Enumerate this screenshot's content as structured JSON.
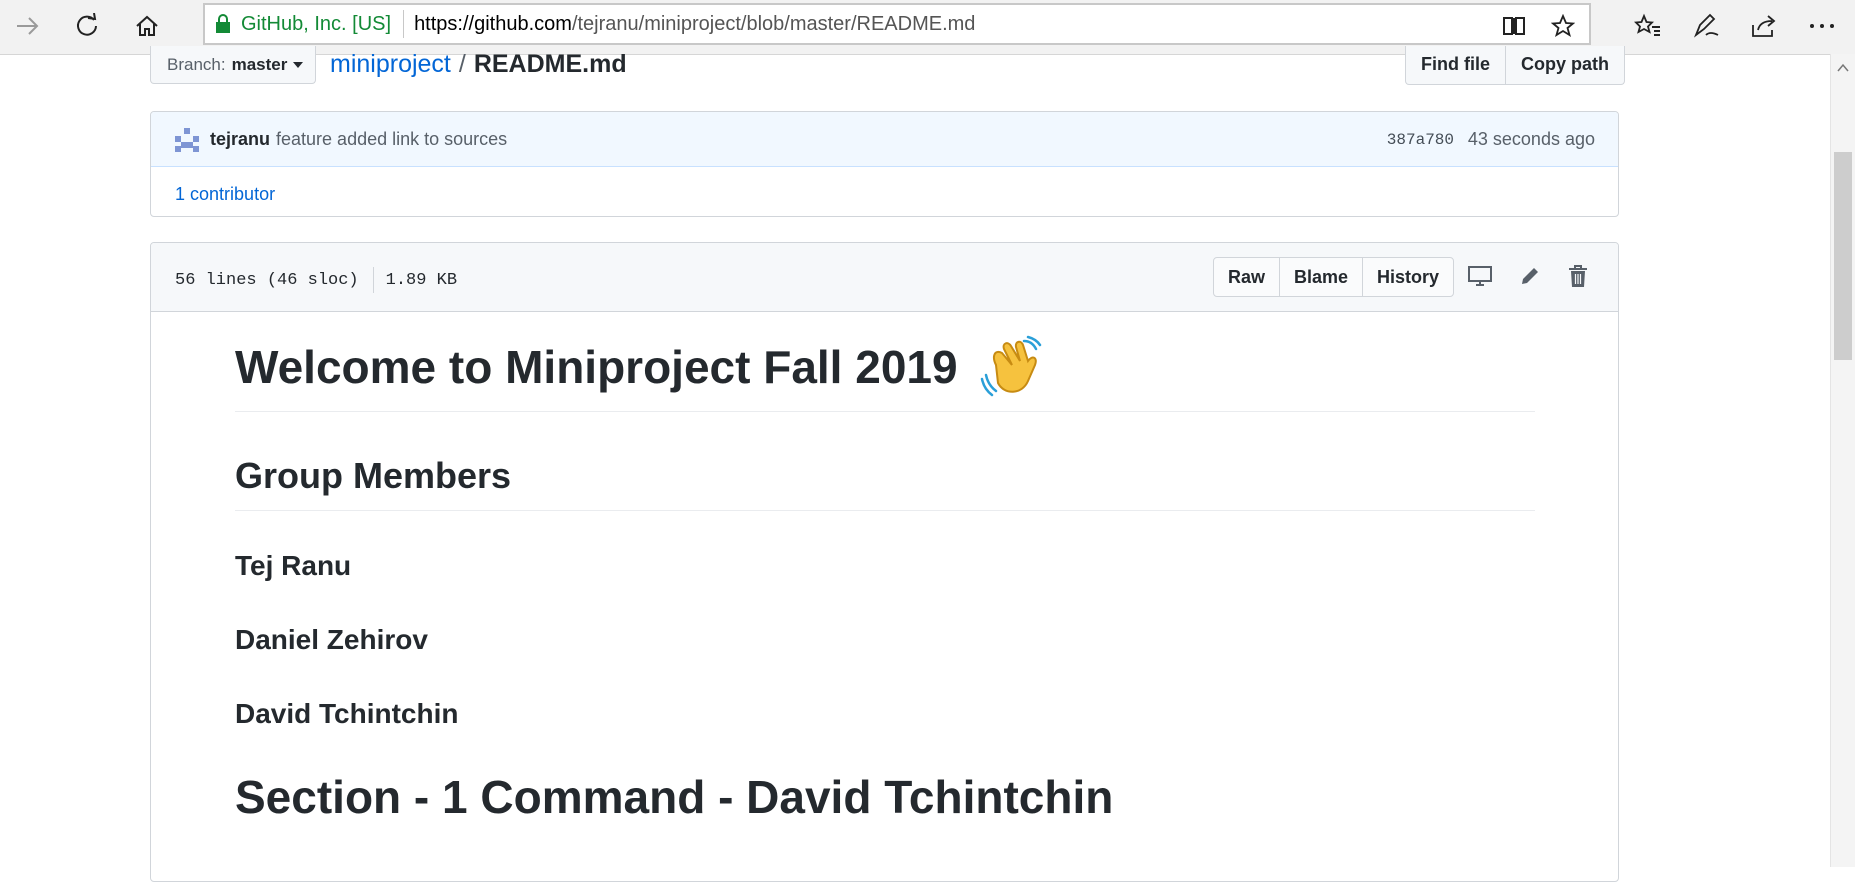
{
  "browser": {
    "site_identity": "GitHub, Inc. [US]",
    "url_host": "https://github.com",
    "url_path": "/tejranu/miniproject/blob/master/README.md",
    "icons": [
      "back-arrow-icon",
      "refresh-icon",
      "home-icon",
      "lock-icon",
      "reading-view-icon",
      "favorite-star-icon",
      "favorites-hub-icon",
      "pen-icon",
      "share-icon",
      "more-icon"
    ]
  },
  "repo_nav": {
    "branch_label": "Branch:",
    "branch_name": "master",
    "repo_link": "miniproject",
    "separator": "/",
    "file_name": "README.md",
    "find_file": "Find file",
    "copy_path": "Copy path"
  },
  "commit": {
    "author": "tejranu",
    "message": "feature added link to sources",
    "sha": "387a780",
    "time": "43 seconds ago",
    "contributors_count": "1",
    "contributors_label": "contributor"
  },
  "file": {
    "lines_info": "56 lines (46 sloc)",
    "size": "1.89 KB",
    "raw": "Raw",
    "blame": "Blame",
    "history": "History"
  },
  "readme": {
    "title": "Welcome to Miniproject Fall 2019",
    "group_heading": "Group Members",
    "members": [
      "Tej Ranu",
      "Daniel Zehirov",
      "David Tchintchin"
    ],
    "section1": "Section - 1 Command - David Tchintchin"
  },
  "colors": {
    "link": "#0366d6",
    "secure_green": "#138a36",
    "commit_bg": "#f1f8ff"
  }
}
